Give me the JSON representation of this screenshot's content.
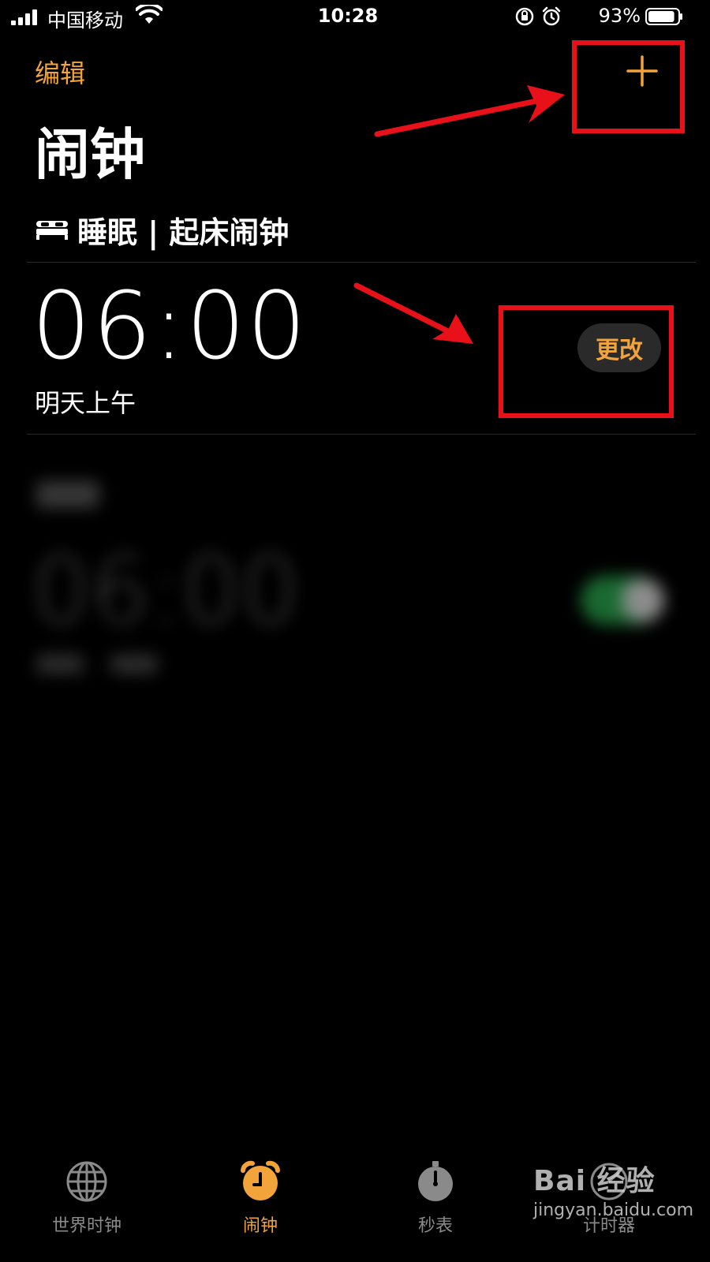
{
  "status": {
    "carrier": "中国移动",
    "time": "10:28",
    "battery_percent": "93%",
    "battery_level": 0.93,
    "icons": [
      "cellular-signal-icon",
      "wifi-icon",
      "orientation-lock-icon",
      "alarm-icon",
      "battery-icon"
    ]
  },
  "header": {
    "edit_label": "编辑",
    "add_icon": "plus-icon",
    "title": "闹钟"
  },
  "sleep_section": {
    "icon": "bed-icon",
    "title": "睡眠 | 起床闹钟"
  },
  "wake_alarm": {
    "time": "06:00",
    "subtitle": "明天上午",
    "change_label": "更改"
  },
  "blurred_alarm": {
    "time": "06:00",
    "toggle_on": true
  },
  "tabbar": {
    "tabs": [
      {
        "label": "世界时钟",
        "icon": "globe-icon",
        "active": false
      },
      {
        "label": "闹钟",
        "icon": "alarm-clock-icon",
        "active": true
      },
      {
        "label": "秒表",
        "icon": "stopwatch-icon",
        "active": false
      },
      {
        "label": "计时器",
        "icon": "timer-icon",
        "active": false
      }
    ]
  },
  "watermark": {
    "brand": "Bai 经验",
    "url": "jingyan.baidu.com"
  },
  "colors": {
    "accent": "#f2a33a",
    "background": "#000000",
    "annotation": "#e8111a",
    "toggle_on": "#30c05a"
  }
}
